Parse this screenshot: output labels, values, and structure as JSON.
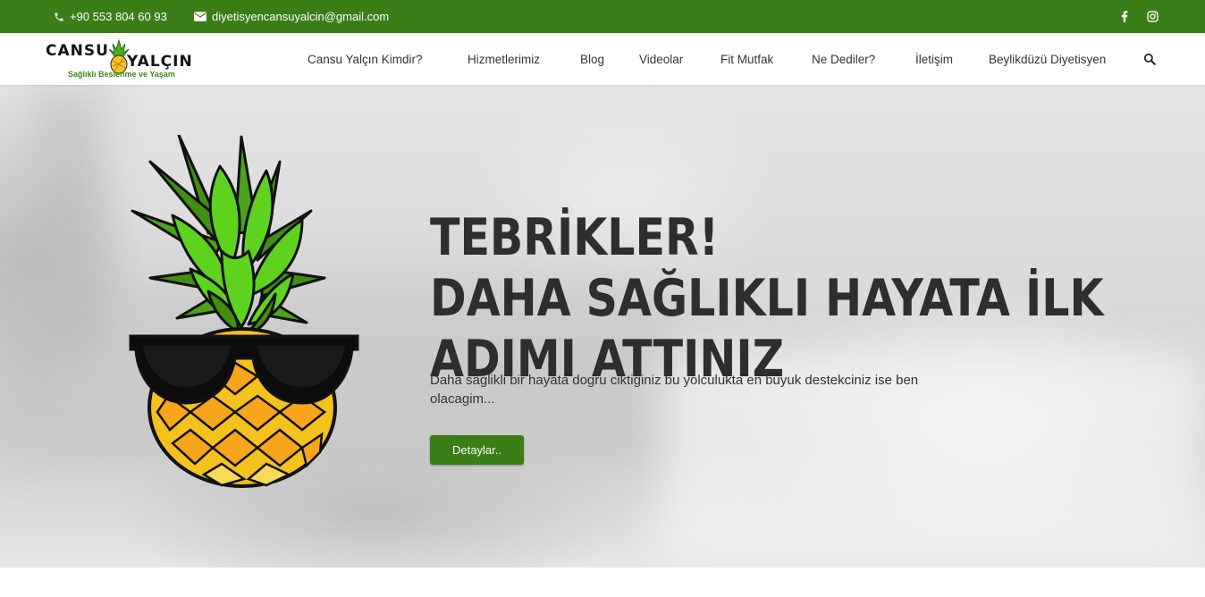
{
  "topbar": {
    "phone": "+90 553 804 60 93",
    "email": "diyetisyencansuyalcin@gmail.com",
    "social": [
      "facebook-icon",
      "instagram-icon"
    ]
  },
  "logo": {
    "line1": "CANSU",
    "line2": "YALÇIN",
    "tagline": "Sağlıklı Beslenme ve Yaşam"
  },
  "nav": {
    "items": [
      {
        "label": "Cansu Yalçın Kimdir?"
      },
      {
        "label": "Hizmetlerimiz"
      },
      {
        "label": "Blog"
      },
      {
        "label": "Videolar"
      },
      {
        "label": "Fit Mutfak"
      },
      {
        "label": "Ne Dediler?"
      },
      {
        "label": "İletişim"
      },
      {
        "label": "Beylikdüzü Diyetisyen"
      }
    ],
    "search_icon": "search-icon"
  },
  "hero": {
    "headline": [
      "TEBRİKLER!",
      "DAHA SAĞLIKLI HAYATA İLK",
      "ADIMI ATTINIZ"
    ],
    "subtext": "Daha saglikli bir hayata dogru ciktiginiz bu yolculukta en buyuk destekciniz ise ben olacagim...",
    "button_label": "Detaylar.."
  },
  "colors": {
    "brand_green": "#3b7d16",
    "heading": "#2e2e2e"
  }
}
